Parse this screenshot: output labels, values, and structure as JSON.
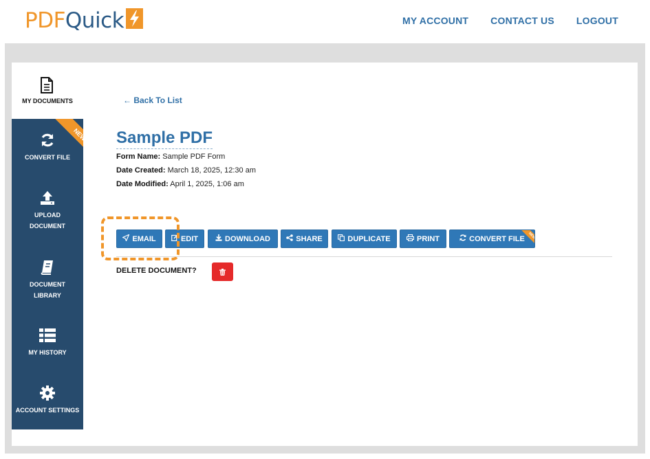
{
  "header": {
    "logo_pdf": "PDF",
    "logo_quick": "Quick",
    "nav": [
      "MY ACCOUNT",
      "CONTACT US",
      "LOGOUT"
    ]
  },
  "sidebar": {
    "top": {
      "label": "MY DOCUMENTS",
      "icon": "document-icon"
    },
    "items": [
      {
        "label": "CONVERT FILE",
        "icon": "sync-icon",
        "badge": "NEW"
      },
      {
        "label_line1": "UPLOAD",
        "label_line2": "DOCUMENT",
        "icon": "upload-icon"
      },
      {
        "label_line1": "DOCUMENT",
        "label_line2": "LIBRARY",
        "icon": "book-icon"
      },
      {
        "label": "MY HISTORY",
        "icon": "list-icon"
      },
      {
        "label": "ACCOUNT SETTINGS",
        "icon": "gear-icon"
      }
    ]
  },
  "main": {
    "back_link": "← Back To List",
    "title": "Sample PDF",
    "meta": [
      {
        "key": "Form Name:",
        "value": "Sample PDF Form"
      },
      {
        "key": "Date Created:",
        "value": "March 18, 2025, 12:30 am"
      },
      {
        "key": "Date Modified:",
        "value": "April 1, 2025, 1:06 am"
      }
    ],
    "actions": [
      {
        "label": "EMAIL",
        "icon": "send-icon"
      },
      {
        "label": "EDIT",
        "icon": "edit-icon"
      },
      {
        "label": "DOWNLOAD",
        "icon": "download-icon"
      },
      {
        "label": "SHARE",
        "icon": "share-icon"
      },
      {
        "label": "DUPLICATE",
        "icon": "copy-icon"
      },
      {
        "label": "PRINT",
        "icon": "print-icon"
      },
      {
        "label": "CONVERT FILE",
        "icon": "sync-icon",
        "badge": "NEW"
      }
    ],
    "delete_label": "DELETE DOCUMENT?"
  },
  "colors": {
    "accent": "#f0962a",
    "brand_blue": "#2b5a86",
    "button_blue": "#2f78b7",
    "sidebar": "#274b6d",
    "danger": "#e52a2a"
  }
}
